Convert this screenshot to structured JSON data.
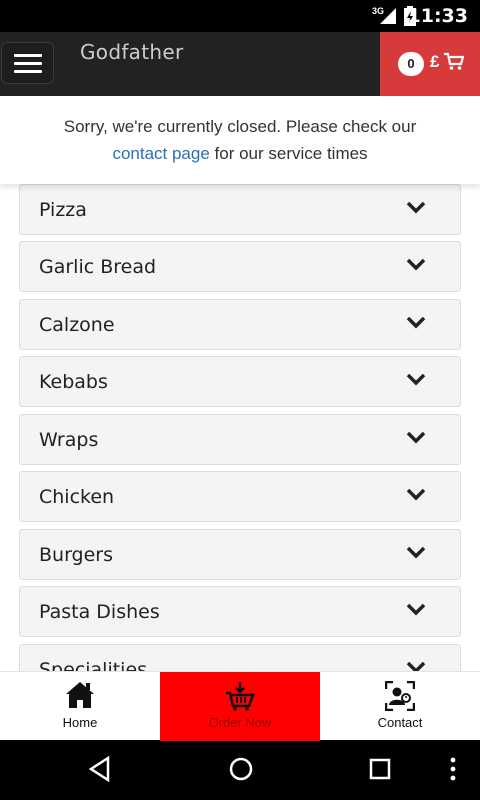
{
  "status_bar": {
    "network": "3G",
    "time": "11:33"
  },
  "header": {
    "brand": "Godfather",
    "cart_count": "0",
    "currency": "£"
  },
  "notice": {
    "line1": "Sorry, we're currently closed. Please check our",
    "link": "contact page",
    "line2_rest": " for our service times"
  },
  "categories": [
    {
      "label": "Pizza"
    },
    {
      "label": "Garlic Bread"
    },
    {
      "label": "Calzone"
    },
    {
      "label": "Kebabs"
    },
    {
      "label": "Wraps"
    },
    {
      "label": "Chicken"
    },
    {
      "label": "Burgers"
    },
    {
      "label": "Pasta Dishes"
    },
    {
      "label": "Specialities"
    }
  ],
  "bottom_nav": {
    "home": "Home",
    "order": "Order Now",
    "contact": "Contact"
  },
  "colors": {
    "header_bg": "#222222",
    "cart_bg": "#d63a3a",
    "order_now_bg": "#ff0000",
    "link": "#2a6ebb"
  }
}
